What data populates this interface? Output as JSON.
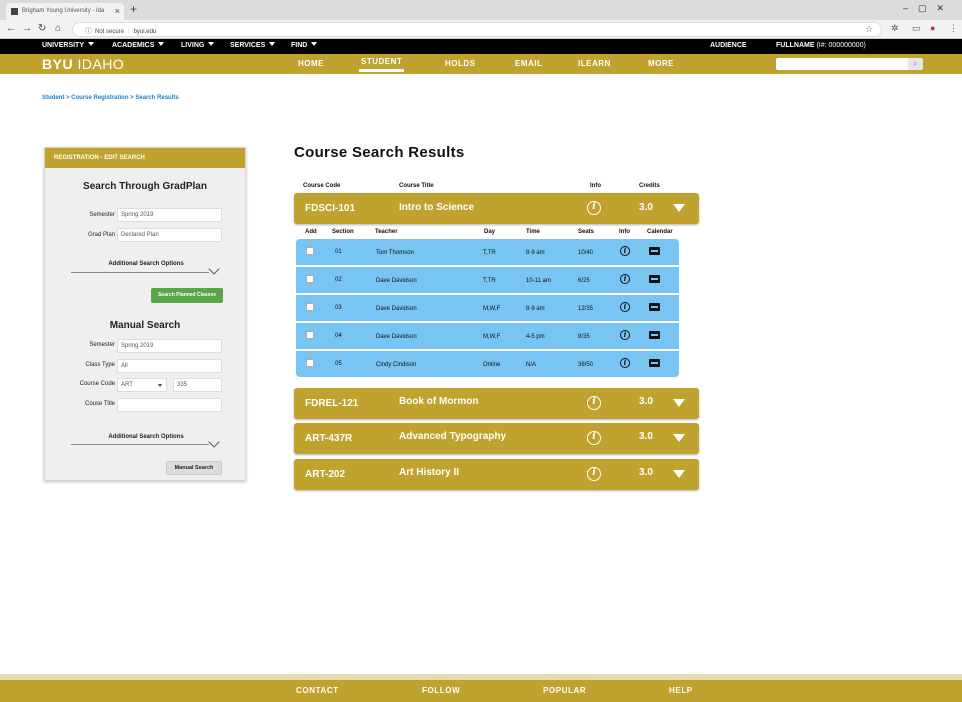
{
  "browser": {
    "tab_title": "Brigham Young University - Ida",
    "url_security": "Not secure",
    "url": "byui.edu"
  },
  "top_nav": {
    "menus": [
      "UNIVERSITY",
      "ACADEMICS",
      "LIVING",
      "SERVICES",
      "FIND"
    ],
    "audience": "AUDIENCE",
    "fullname_label": "FULLNAME",
    "fullname_id": "(I#: 000000000)"
  },
  "main_nav": {
    "logo_bold": "BYU",
    "logo_light": "IDAHO",
    "items": [
      "HOME",
      "STUDENT",
      "HOLDS",
      "EMAIL",
      "ILEARN",
      "MORE"
    ],
    "active": "STUDENT"
  },
  "breadcrumb": "Student > Course Registration > Search Results",
  "panel": {
    "header": "REGISTRATION - EDIT SEARCH",
    "gradplan": {
      "heading": "Search Through GradPlan",
      "semester_label": "Semester",
      "semester_value": "Spring 2019",
      "gradplan_label": "Grad Plan",
      "gradplan_value": "Declared Plan",
      "additional": "Additional Search Options",
      "button": "Search Planned Classes"
    },
    "manual": {
      "heading": "Manual Search",
      "semester_label": "Semester",
      "semester_value": "Spring 2019",
      "classtype_label": "Class Type",
      "classtype_value": "All",
      "coursecode_label": "Course Code",
      "coursecode_dept": "ART",
      "coursecode_num": "335",
      "coursetitle_label": "Couse Title",
      "coursetitle_value": "",
      "additional": "Additional Search Options",
      "button": "Manual Search"
    }
  },
  "results": {
    "title": "Course Search Results",
    "headers": {
      "code": "Course Code",
      "title": "Course Title",
      "info": "Info",
      "credits": "Credits"
    },
    "section_headers": [
      "Add",
      "Section",
      "Teacher",
      "Day",
      "Time",
      "Seats",
      "Info",
      "Calendar"
    ],
    "courses": [
      {
        "code": "FDSCI-101",
        "title": "Intro to Science",
        "info": "i",
        "credits": "3.0"
      },
      {
        "code": "FDREL-121",
        "title": "Book of Mormon",
        "info": "i",
        "credits": "3.0"
      },
      {
        "code": "ART-437R",
        "title": "Advanced Typography",
        "info": "i",
        "credits": "3.0"
      },
      {
        "code": "ART-202",
        "title": "Art History II",
        "info": "i",
        "credits": "3.0"
      }
    ],
    "sections": [
      {
        "section": "01",
        "teacher": "Tom Thomson",
        "day": "T,TR",
        "time": "8-9 am",
        "seats": "10/40"
      },
      {
        "section": "02",
        "teacher": "Dave Davidson",
        "day": "T,TR",
        "time": "10-11 am",
        "seats": "6/25"
      },
      {
        "section": "03",
        "teacher": "Dave Davidson",
        "day": "M,W,F",
        "time": "8-9 am",
        "seats": "12/35"
      },
      {
        "section": "04",
        "teacher": "Dave Davidson",
        "day": "M,W,F",
        "time": "4-5 pm",
        "seats": "8/35"
      },
      {
        "section": "05",
        "teacher": "Cindy Cindison",
        "day": "Online",
        "time": "N/A",
        "seats": "38/50"
      }
    ]
  },
  "footer": [
    "CONTACT",
    "FOLLOW",
    "POPULAR",
    "HELP"
  ],
  "colors": {
    "gold": "#c0a22e",
    "sections_blue": "#78c4f2",
    "green_button": "#5aa646",
    "link_blue": "#1e7fc8"
  }
}
